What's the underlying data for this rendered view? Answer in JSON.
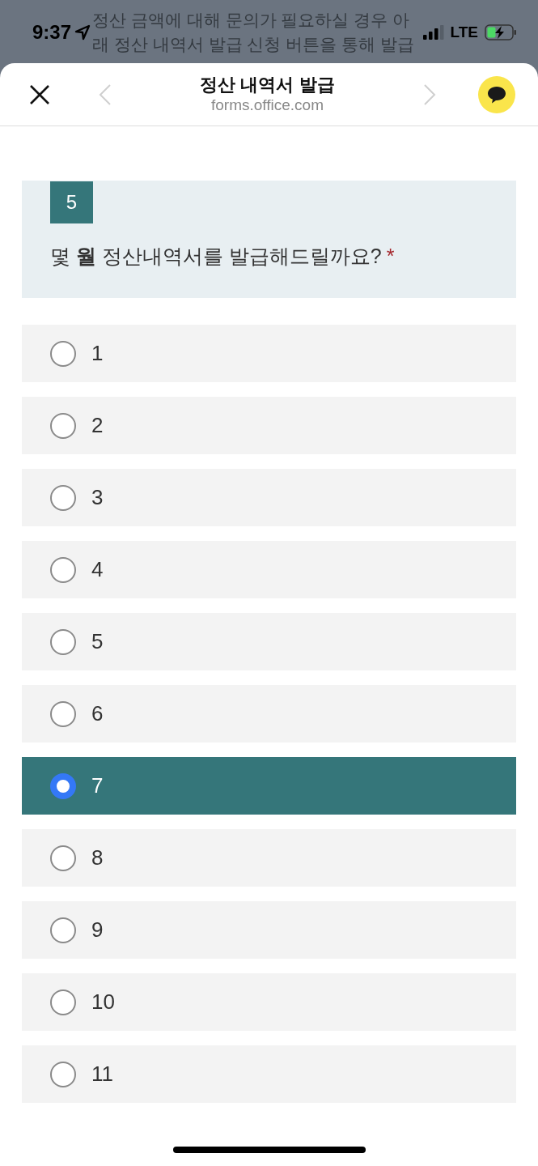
{
  "background_text": [
    "정산 금액에 대해 문의가 필요하실 경우 아",
    "래 정산 내역서 발급 신청 버튼을 통해 발급"
  ],
  "status_bar": {
    "time": "9:37",
    "network": "LTE"
  },
  "header": {
    "title": "정산 내역서 발급",
    "url": "forms.office.com",
    "back": {
      "disabled": true
    },
    "forward": {
      "disabled": true
    }
  },
  "question": {
    "number": "5",
    "text": "몇 **월** 정산내역서를 발급해드릴까요?",
    "required_mark": "*"
  },
  "options": [
    {
      "label": "1",
      "selected": false
    },
    {
      "label": "2",
      "selected": false
    },
    {
      "label": "3",
      "selected": false
    },
    {
      "label": "4",
      "selected": false
    },
    {
      "label": "5",
      "selected": false
    },
    {
      "label": "6",
      "selected": false
    },
    {
      "label": "7",
      "selected": true
    },
    {
      "label": "8",
      "selected": false
    },
    {
      "label": "9",
      "selected": false
    },
    {
      "label": "10",
      "selected": false
    },
    {
      "label": "11",
      "selected": false
    }
  ]
}
